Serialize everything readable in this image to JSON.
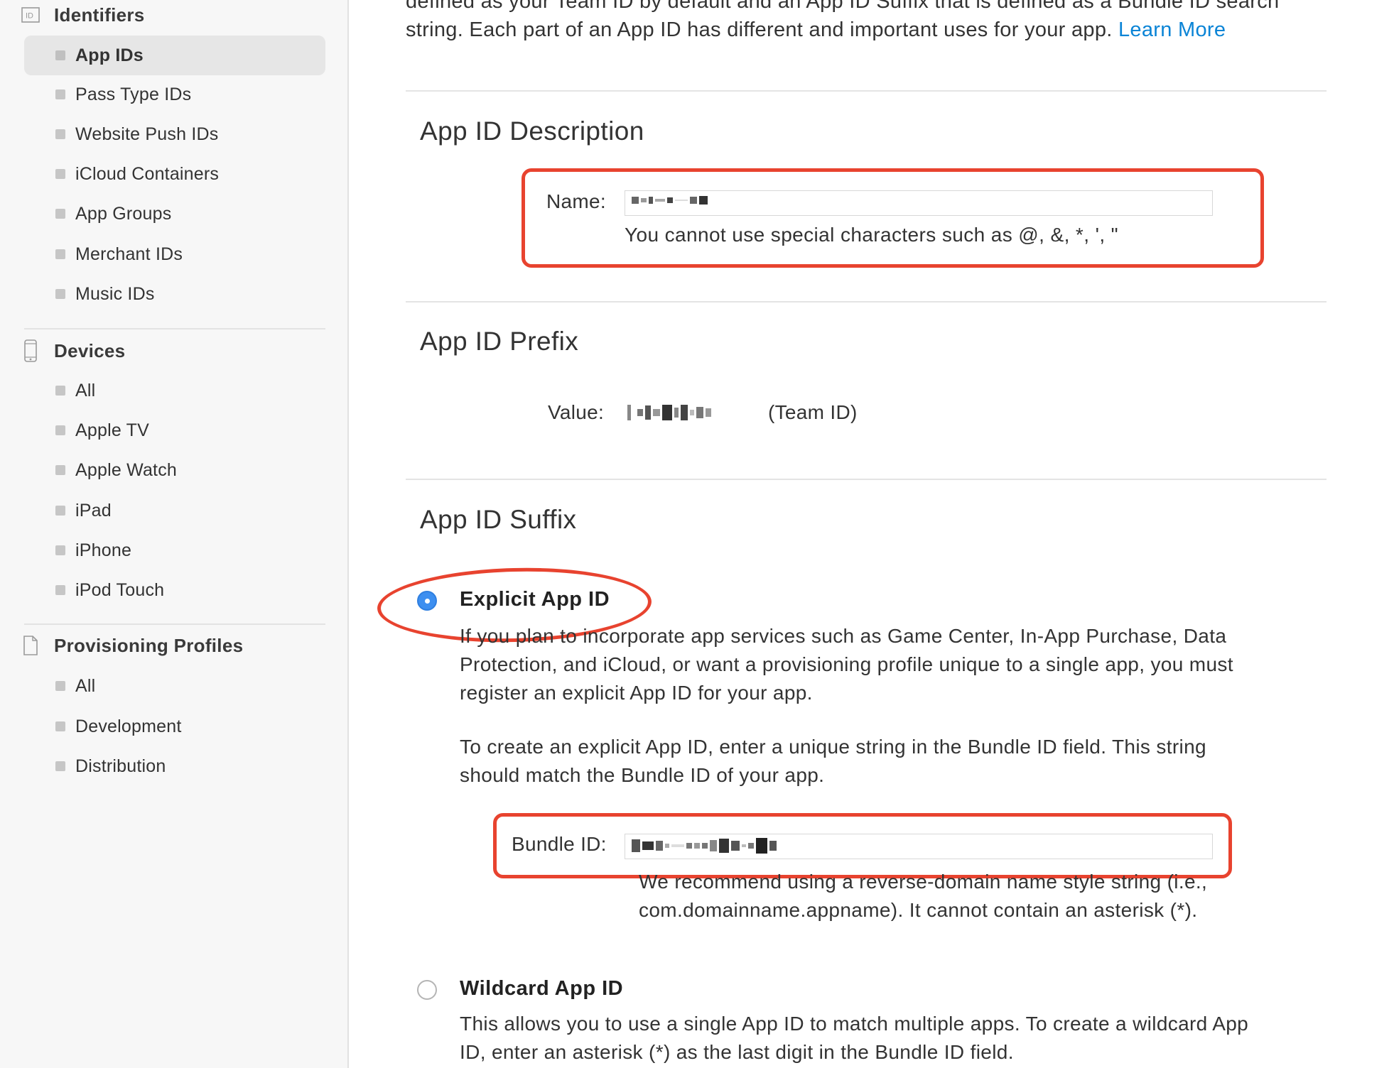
{
  "sidebar": {
    "identifiers": {
      "title": "Identifiers",
      "icon": "id-icon",
      "items": [
        {
          "label": "App IDs",
          "active": true
        },
        {
          "label": "Pass Type IDs"
        },
        {
          "label": "Website Push IDs"
        },
        {
          "label": "iCloud Containers"
        },
        {
          "label": "App Groups"
        },
        {
          "label": "Merchant IDs"
        },
        {
          "label": "Music IDs"
        }
      ]
    },
    "devices": {
      "title": "Devices",
      "icon": "iphone-icon",
      "items": [
        {
          "label": "All"
        },
        {
          "label": "Apple TV"
        },
        {
          "label": "Apple Watch"
        },
        {
          "label": "iPad"
        },
        {
          "label": "iPhone"
        },
        {
          "label": "iPod Touch"
        }
      ]
    },
    "profiles": {
      "title": "Provisioning Profiles",
      "icon": "document-icon",
      "items": [
        {
          "label": "All"
        },
        {
          "label": "Development"
        },
        {
          "label": "Distribution"
        }
      ]
    }
  },
  "intro": {
    "line1": "defined as your Team ID by default and an App ID Suffix that is defined as a Bundle ID search",
    "line2": "string. Each part of an App ID has different and important uses for your app.",
    "learn_more": "Learn More"
  },
  "description": {
    "heading": "App ID Description",
    "name_label": "Name:",
    "name_hint": "You cannot use special characters such as @, &, *, ', \""
  },
  "prefix": {
    "heading": "App ID Prefix",
    "value_label": "Value:",
    "team_suffix": "(Team ID)"
  },
  "suffix": {
    "heading": "App ID Suffix",
    "explicit": {
      "title": "Explicit App ID",
      "selected": true,
      "desc1": [
        "If you plan to incorporate app services such as Game Center, In-App Purchase, Data",
        "Protection, and iCloud, or want a provisioning profile unique to a single app, you must",
        "register an explicit App ID for your app."
      ],
      "desc2": [
        "To create an explicit App ID, enter a unique string in the Bundle ID field. This string",
        "should match the Bundle ID of your app."
      ],
      "bundle_label": "Bundle ID:",
      "bundle_hint": [
        "We recommend using a reverse-domain name style string (i.e.,",
        "com.domainname.appname). It cannot contain an asterisk (*)."
      ]
    },
    "wildcard": {
      "title": "Wildcard App ID",
      "selected": false,
      "desc": [
        "This allows you to use a single App ID to match multiple apps. To create a wildcard App",
        "ID, enter an asterisk (*) as the last digit in the Bundle ID field."
      ]
    }
  },
  "colors": {
    "link": "#0a84d6",
    "annotation_red": "#e8432f",
    "radio_selected": "#3d8ff0",
    "sidebar_bg": "#f7f7f7",
    "active_item_bg": "#e6e6e6"
  }
}
